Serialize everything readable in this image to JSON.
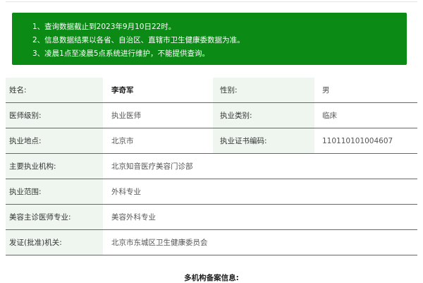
{
  "notice": {
    "lines": [
      "1、查询数据截止到2023年9月10日22时。",
      "2、信息数据结果以各省、自治区、直辖市卫生健康委数据为准。",
      "3、凌晨1点至凌晨5点系统进行维护，不能提供查询。"
    ]
  },
  "doctor": {
    "name_label": "姓名:",
    "name": "李奇军",
    "gender_label": "性别:",
    "gender": "男",
    "level_label": "医师级别:",
    "level": "执业医师",
    "category_label": "执业类别:",
    "category": "临床",
    "location_label": "执业地点:",
    "location": "北京市",
    "cert_label": "执业证书编码:",
    "cert": "110110101004607",
    "org_label": "主要执业机构:",
    "org": "北京知音医疗美容门诊部",
    "scope_label": "执业范围:",
    "scope": "外科专业",
    "cosmetic_label": "美容主诊医师专业:",
    "cosmetic": "美容外科专业",
    "issuer_label": "发证(批准)机关:",
    "issuer": "北京市东城区卫生健康委员会"
  },
  "footer": {
    "multi_org_title": "多机构备案信息:"
  },
  "colors": {
    "notice_bg": "#0b8a15",
    "label_bg": "#eef6ef",
    "row_border": "#3d7d68"
  }
}
